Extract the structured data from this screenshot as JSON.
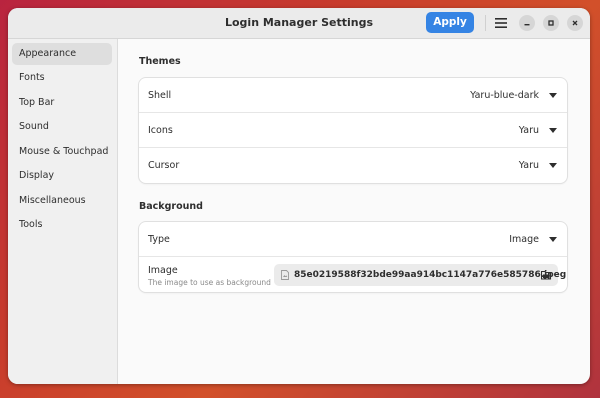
{
  "window": {
    "title": "Login Manager Settings",
    "apply_label": "Apply"
  },
  "sidebar": {
    "items": [
      {
        "label": "Appearance",
        "active": true
      },
      {
        "label": "Fonts"
      },
      {
        "label": "Top Bar"
      },
      {
        "label": "Sound"
      },
      {
        "label": "Mouse & Touchpad"
      },
      {
        "label": "Display"
      },
      {
        "label": "Miscellaneous"
      },
      {
        "label": "Tools"
      }
    ]
  },
  "themes": {
    "title": "Themes",
    "rows": [
      {
        "label": "Shell",
        "value": "Yaru-blue-dark"
      },
      {
        "label": "Icons",
        "value": "Yaru"
      },
      {
        "label": "Cursor",
        "value": "Yaru"
      }
    ]
  },
  "background": {
    "title": "Background",
    "type_label": "Type",
    "type_value": "Image",
    "image_label": "Image",
    "image_subtitle": "The image to use as background",
    "image_file": "85e0219588f32bde99aa914bc1147a776e585786.jpeg"
  },
  "colors": {
    "accent": "#3584e4",
    "window_bg": "#fafafa",
    "sidebar_bg": "#f0f0f0"
  },
  "icons": {
    "menu": "hamburger-menu-icon",
    "minimize": "minimize-icon",
    "maximize": "maximize-icon",
    "close": "close-icon",
    "file": "file-icon",
    "open": "open-folder-icon",
    "dropdown": "dropdown-arrow-icon"
  }
}
